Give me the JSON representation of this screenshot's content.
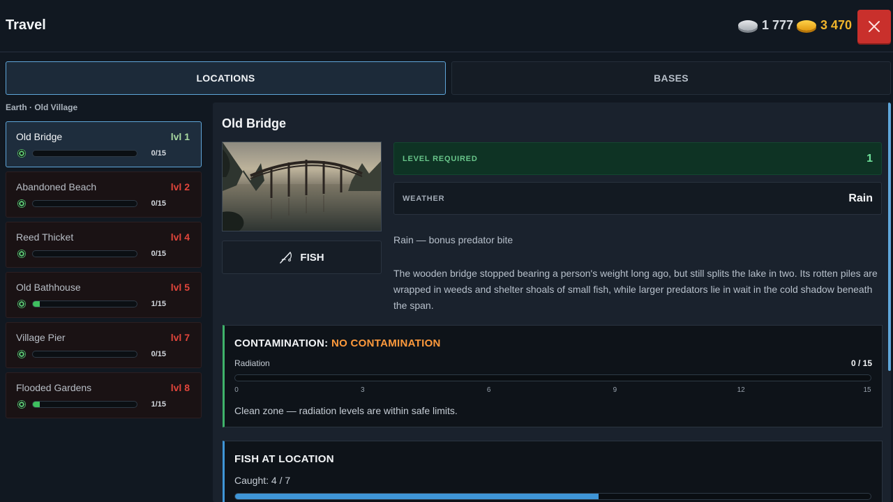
{
  "header": {
    "title": "Travel",
    "silver": "1 777",
    "gold": "3 470",
    "close_icon": "close-icon"
  },
  "tabs": [
    {
      "label": "LOCATIONS",
      "active": true
    },
    {
      "label": "BASES",
      "active": false
    }
  ],
  "sidebar": {
    "breadcrumb": "Earth · Old Village",
    "locations": [
      {
        "name": "Old Bridge",
        "level": "lvl 1",
        "count": "0/15",
        "progress": 0,
        "active": true
      },
      {
        "name": "Abandoned Beach",
        "level": "lvl 2",
        "count": "0/15",
        "progress": 0,
        "active": false
      },
      {
        "name": "Reed Thicket",
        "level": "lvl 4",
        "count": "0/15",
        "progress": 0,
        "active": false
      },
      {
        "name": "Old Bathhouse",
        "level": "lvl 5",
        "count": "1/15",
        "progress": 0.0667,
        "active": false
      },
      {
        "name": "Village Pier",
        "level": "lvl 7",
        "count": "0/15",
        "progress": 0,
        "active": false
      },
      {
        "name": "Flooded Gardens",
        "level": "lvl 8",
        "count": "1/15",
        "progress": 0.0667,
        "active": false
      }
    ]
  },
  "main": {
    "title": "Old Bridge",
    "fish_button": "FISH",
    "level_required": {
      "label": "LEVEL REQUIRED",
      "value": "1"
    },
    "weather": {
      "label": "WEATHER",
      "value": "Rain"
    },
    "weather_note": "Rain — bonus predator bite",
    "description": "The wooden bridge stopped bearing a person's weight long ago, but still splits the lake in two. Its rotten piles are wrapped in weeds and shelter shoals of small fish, while larger predators lie in wait in the cold shadow beneath the span.",
    "contamination": {
      "title": "CONTAMINATION:",
      "status": "NO CONTAMINATION",
      "radiation_label": "Radiation",
      "radiation_value": "0 / 15",
      "radiation_progress": 0,
      "ticks": [
        "0",
        "3",
        "6",
        "9",
        "12",
        "15"
      ],
      "note": "Clean zone — radiation levels are within safe limits."
    },
    "fish_at_location": {
      "title": "FISH AT LOCATION",
      "caught": "Caught: 4 / 7",
      "progress": 0.5714
    }
  },
  "colors": {
    "accent": "#5fa6da",
    "danger": "#c9302c",
    "gold": "#f1b52b",
    "green": "#3fbf5f",
    "orange": "#ff9a3c"
  }
}
